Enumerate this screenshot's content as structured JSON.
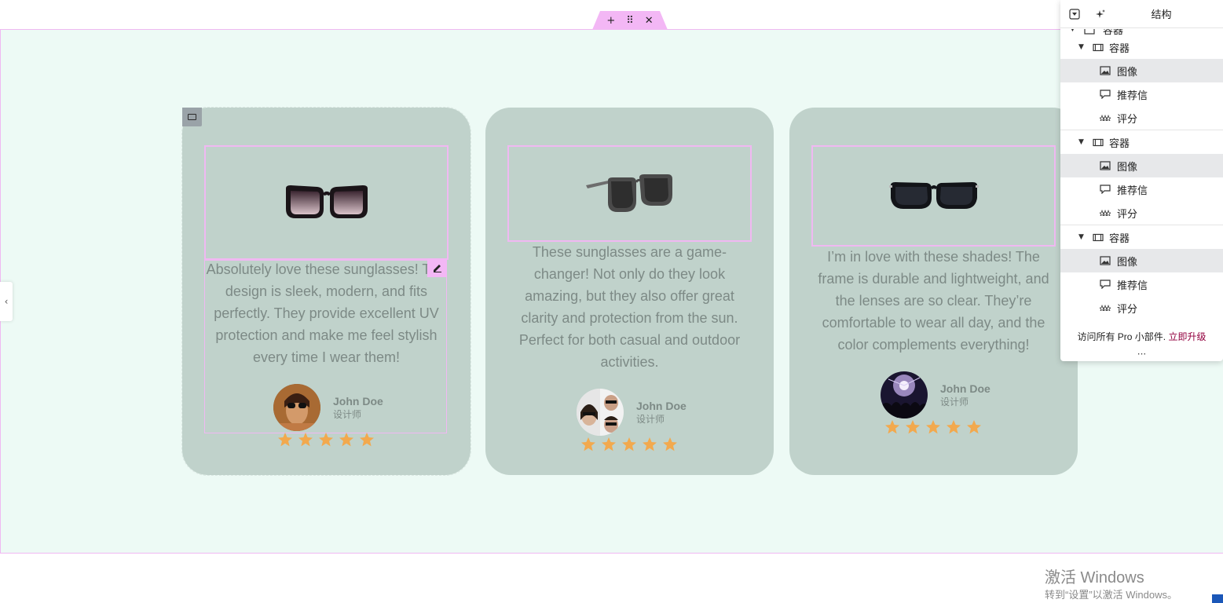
{
  "toolbar": {
    "add_icon": "plus-icon",
    "drag_icon": "grip-icon",
    "close_icon": "close-icon"
  },
  "colors": {
    "section_bg": "#edfaf5",
    "card_bg": "#c0d2cb",
    "accent_pink": "#f3b7f5",
    "star": "#f2a94e",
    "text": "#7d8a86",
    "upgrade_link": "#93003f"
  },
  "cards": [
    {
      "review": "Absolutely love these sunglasses! The design is sleek, modern, and fits perfectly. They provide excellent UV protection and make me feel stylish every time I wear them!",
      "author": "John Doe",
      "role": "设计师",
      "rating": 5
    },
    {
      "review": "These sunglasses are a game-changer! Not only do they look amazing, but they also offer great clarity and protection from the sun. Perfect for both casual and outdoor activities.",
      "author": "John Doe",
      "role": "设计师",
      "rating": 5
    },
    {
      "review": "I’m in love with these shades! The frame is durable and lightweight, and the lenses are so clear. They’re comfortable to wear all day, and the color complements everything!",
      "author": "John Doe",
      "role": "设计师",
      "rating": 5
    }
  ],
  "navigator": {
    "title": "结构",
    "items": [
      {
        "label": "容器",
        "type": "container"
      },
      {
        "label": "容器",
        "type": "container"
      },
      {
        "label": "图像",
        "type": "image"
      },
      {
        "label": "推荐信",
        "type": "testimonial"
      },
      {
        "label": "评分",
        "type": "rating"
      },
      {
        "label": "容器",
        "type": "container"
      },
      {
        "label": "图像",
        "type": "image"
      },
      {
        "label": "推荐信",
        "type": "testimonial"
      },
      {
        "label": "评分",
        "type": "rating"
      },
      {
        "label": "容器",
        "type": "container"
      },
      {
        "label": "图像",
        "type": "image"
      },
      {
        "label": "推荐信",
        "type": "testimonial"
      },
      {
        "label": "评分",
        "type": "rating"
      }
    ],
    "promo_text": "访问所有 Pro 小部件.",
    "upgrade_link": "立即升级",
    "more": "···"
  },
  "watermark": {
    "title": "激活 Windows",
    "subtitle": "转到“设置”以激活 Windows。"
  }
}
